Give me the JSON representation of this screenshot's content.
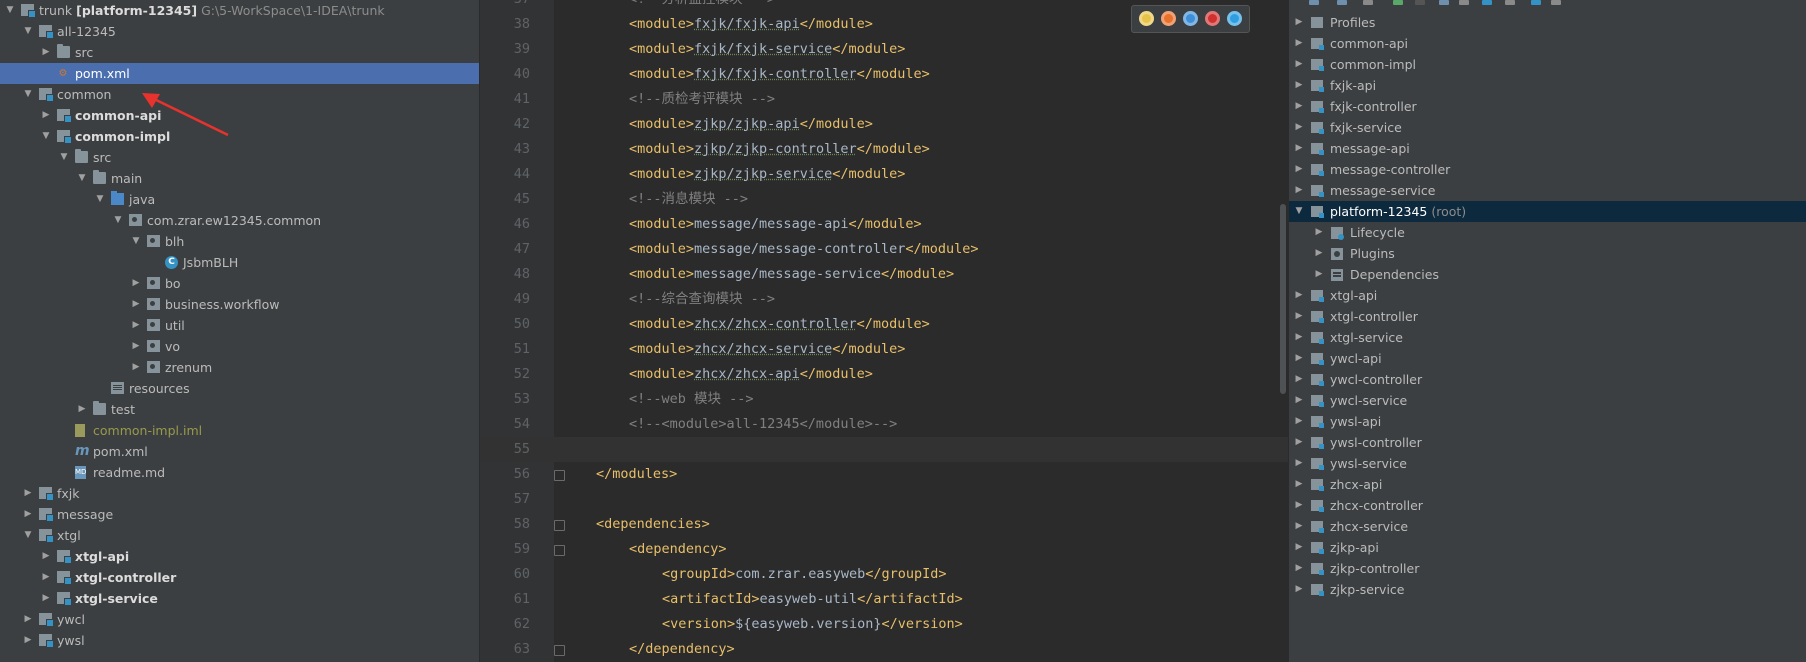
{
  "project_tree": {
    "items": [
      {
        "label": "trunk",
        "bold_suffix": "[platform-12345]",
        "path": "G:\\5-WorkSpace\\1-IDEA\\trunk",
        "depth": 0,
        "arrow": "down",
        "icon": "module-folder-icon"
      },
      {
        "label": "all-12345",
        "depth": 1,
        "arrow": "down",
        "icon": "module-folder-icon"
      },
      {
        "label": "src",
        "depth": 2,
        "arrow": "right",
        "icon": "folder-icon"
      },
      {
        "label": "pom.xml",
        "depth": 2,
        "arrow": "",
        "icon": "maven-file-icon",
        "selected": true
      },
      {
        "label": "common",
        "depth": 1,
        "arrow": "down",
        "icon": "module-folder-icon"
      },
      {
        "label": "common-api",
        "depth": 2,
        "arrow": "right",
        "icon": "module-folder-icon",
        "bold": true
      },
      {
        "label": "common-impl",
        "depth": 2,
        "arrow": "down",
        "icon": "module-folder-icon",
        "bold": true
      },
      {
        "label": "src",
        "depth": 3,
        "arrow": "down",
        "icon": "folder-icon"
      },
      {
        "label": "main",
        "depth": 4,
        "arrow": "down",
        "icon": "folder-icon"
      },
      {
        "label": "java",
        "depth": 5,
        "arrow": "down",
        "icon": "source-folder-icon"
      },
      {
        "label": "com.zrar.ew12345.common",
        "depth": 6,
        "arrow": "down",
        "icon": "package-icon"
      },
      {
        "label": "blh",
        "depth": 7,
        "arrow": "down",
        "icon": "package-icon"
      },
      {
        "label": "JsbmBLH",
        "depth": 8,
        "arrow": "",
        "icon": "class-icon"
      },
      {
        "label": "bo",
        "depth": 7,
        "arrow": "right",
        "icon": "package-icon"
      },
      {
        "label": "business.workflow",
        "depth": 7,
        "arrow": "right",
        "icon": "package-icon"
      },
      {
        "label": "util",
        "depth": 7,
        "arrow": "right",
        "icon": "package-icon"
      },
      {
        "label": "vo",
        "depth": 7,
        "arrow": "right",
        "icon": "package-icon"
      },
      {
        "label": "zrenum",
        "depth": 7,
        "arrow": "right",
        "icon": "package-icon"
      },
      {
        "label": "resources",
        "depth": 5,
        "arrow": "",
        "icon": "resources-folder-icon"
      },
      {
        "label": "test",
        "depth": 4,
        "arrow": "right",
        "icon": "folder-icon"
      },
      {
        "label": "common-impl.iml",
        "depth": 3,
        "arrow": "",
        "icon": "iml-file-icon",
        "olive": true
      },
      {
        "label": "pom.xml",
        "depth": 3,
        "arrow": "",
        "icon": "maven-m-icon"
      },
      {
        "label": "readme.md",
        "depth": 3,
        "arrow": "",
        "icon": "markdown-file-icon"
      },
      {
        "label": "fxjk",
        "depth": 1,
        "arrow": "right",
        "icon": "module-folder-icon"
      },
      {
        "label": "message",
        "depth": 1,
        "arrow": "right",
        "icon": "module-folder-icon"
      },
      {
        "label": "xtgl",
        "depth": 1,
        "arrow": "down",
        "icon": "module-folder-icon"
      },
      {
        "label": "xtgl-api",
        "depth": 2,
        "arrow": "right",
        "icon": "module-folder-icon",
        "bold": true
      },
      {
        "label": "xtgl-controller",
        "depth": 2,
        "arrow": "right",
        "icon": "module-folder-icon",
        "bold": true
      },
      {
        "label": "xtgl-service",
        "depth": 2,
        "arrow": "right",
        "icon": "module-folder-icon",
        "bold": true
      },
      {
        "label": "ywcl",
        "depth": 1,
        "arrow": "right",
        "icon": "module-folder-icon"
      },
      {
        "label": "ywsl",
        "depth": 1,
        "arrow": "right",
        "icon": "module-folder-icon"
      }
    ]
  },
  "editor": {
    "lines": [
      {
        "num": "37",
        "indent": 1,
        "parts": [
          {
            "t": "cmt",
            "v": "<!--分析监控模块 -->"
          }
        ]
      },
      {
        "num": "38",
        "indent": 1,
        "parts": [
          {
            "t": "tag",
            "v": "<module>"
          },
          {
            "t": "txt",
            "v": "fxjk/fxjk-api"
          },
          {
            "t": "tag",
            "v": "</module>"
          }
        ]
      },
      {
        "num": "39",
        "indent": 1,
        "parts": [
          {
            "t": "tag",
            "v": "<module>"
          },
          {
            "t": "txt",
            "v": "fxjk/fxjk-service"
          },
          {
            "t": "tag",
            "v": "</module>"
          }
        ]
      },
      {
        "num": "40",
        "indent": 1,
        "parts": [
          {
            "t": "tag",
            "v": "<module>"
          },
          {
            "t": "txt",
            "v": "fxjk/fxjk-controller"
          },
          {
            "t": "tag",
            "v": "</module>"
          }
        ]
      },
      {
        "num": "41",
        "indent": 1,
        "parts": [
          {
            "t": "cmt",
            "v": "<!--质检考评模块 -->"
          }
        ]
      },
      {
        "num": "42",
        "indent": 1,
        "parts": [
          {
            "t": "tag",
            "v": "<module>"
          },
          {
            "t": "txt",
            "v": "zjkp/zjkp-api"
          },
          {
            "t": "tag",
            "v": "</module>"
          }
        ]
      },
      {
        "num": "43",
        "indent": 1,
        "parts": [
          {
            "t": "tag",
            "v": "<module>"
          },
          {
            "t": "txt",
            "v": "zjkp/zjkp-controller"
          },
          {
            "t": "tag",
            "v": "</module>"
          }
        ]
      },
      {
        "num": "44",
        "indent": 1,
        "parts": [
          {
            "t": "tag",
            "v": "<module>"
          },
          {
            "t": "txt",
            "v": "zjkp/zjkp-service"
          },
          {
            "t": "tag",
            "v": "</module>"
          }
        ]
      },
      {
        "num": "45",
        "indent": 1,
        "parts": [
          {
            "t": "cmt",
            "v": "<!--消息模块 -->"
          }
        ]
      },
      {
        "num": "46",
        "indent": 1,
        "parts": [
          {
            "t": "tag",
            "v": "<module>"
          },
          {
            "t": "txt",
            "v": "message/message-api"
          },
          {
            "t": "tag",
            "v": "</module>"
          }
        ]
      },
      {
        "num": "47",
        "indent": 1,
        "parts": [
          {
            "t": "tag",
            "v": "<module>"
          },
          {
            "t": "txt",
            "v": "message/message-controller"
          },
          {
            "t": "tag",
            "v": "</module>"
          }
        ]
      },
      {
        "num": "48",
        "indent": 1,
        "parts": [
          {
            "t": "tag",
            "v": "<module>"
          },
          {
            "t": "txt",
            "v": "message/message-service"
          },
          {
            "t": "tag",
            "v": "</module>"
          }
        ]
      },
      {
        "num": "49",
        "indent": 1,
        "parts": [
          {
            "t": "cmt",
            "v": "<!--综合查询模块 -->"
          }
        ]
      },
      {
        "num": "50",
        "indent": 1,
        "parts": [
          {
            "t": "tag",
            "v": "<module>"
          },
          {
            "t": "txt",
            "v": "zhcx/zhcx-controller"
          },
          {
            "t": "tag",
            "v": "</module>"
          }
        ]
      },
      {
        "num": "51",
        "indent": 1,
        "parts": [
          {
            "t": "tag",
            "v": "<module>"
          },
          {
            "t": "txt",
            "v": "zhcx/zhcx-service"
          },
          {
            "t": "tag",
            "v": "</module>"
          }
        ]
      },
      {
        "num": "52",
        "indent": 1,
        "parts": [
          {
            "t": "tag",
            "v": "<module>"
          },
          {
            "t": "txt",
            "v": "zhcx/zhcx-api"
          },
          {
            "t": "tag",
            "v": "</module>"
          }
        ]
      },
      {
        "num": "53",
        "indent": 1,
        "parts": [
          {
            "t": "cmt",
            "v": "<!--web 模块 -->"
          }
        ]
      },
      {
        "num": "54",
        "indent": 1,
        "parts": [
          {
            "t": "cmt",
            "v": "<!--<module>all-12345</module>-->"
          }
        ]
      },
      {
        "num": "55",
        "indent": 0,
        "parts": [],
        "current": true
      },
      {
        "num": "56",
        "indent": 0,
        "parts": [
          {
            "t": "tag",
            "v": "</modules>"
          }
        ],
        "fold": true
      },
      {
        "num": "57",
        "indent": 0,
        "parts": []
      },
      {
        "num": "58",
        "indent": 0,
        "parts": [
          {
            "t": "tag",
            "v": "<dependencies>"
          }
        ],
        "fold": true
      },
      {
        "num": "59",
        "indent": 1,
        "parts": [
          {
            "t": "tag",
            "v": "<dependency>"
          }
        ],
        "fold": true
      },
      {
        "num": "60",
        "indent": 2,
        "parts": [
          {
            "t": "tag",
            "v": "<groupId>"
          },
          {
            "t": "txt",
            "v": "com.zrar.easyweb"
          },
          {
            "t": "tag",
            "v": "</groupId>"
          }
        ]
      },
      {
        "num": "61",
        "indent": 2,
        "parts": [
          {
            "t": "tag",
            "v": "<artifactId>"
          },
          {
            "t": "txt",
            "v": "easyweb-util"
          },
          {
            "t": "tag",
            "v": "</artifactId>"
          }
        ]
      },
      {
        "num": "62",
        "indent": 2,
        "parts": [
          {
            "t": "tag",
            "v": "<version>"
          },
          {
            "t": "txt",
            "v": "${easyweb.version}"
          },
          {
            "t": "tag",
            "v": "</version>"
          }
        ]
      },
      {
        "num": "63",
        "indent": 1,
        "parts": [
          {
            "t": "tag",
            "v": "</dependency>"
          }
        ],
        "fold": true
      }
    ],
    "browsers": [
      {
        "name": "chrome-icon",
        "color": "#e8c34a"
      },
      {
        "name": "firefox-icon",
        "color": "#e8712b"
      },
      {
        "name": "safari-icon",
        "color": "#3f8fd8"
      },
      {
        "name": "opera-icon",
        "color": "#d0302f"
      },
      {
        "name": "ie-icon",
        "color": "#2e9ee0"
      }
    ]
  },
  "maven": {
    "items": [
      {
        "label": "Profiles",
        "depth": 0,
        "arrow": "right",
        "icon": "profiles-icon"
      },
      {
        "label": "common-api",
        "depth": 0,
        "arrow": "right",
        "icon": "maven-module-icon"
      },
      {
        "label": "common-impl",
        "depth": 0,
        "arrow": "right",
        "icon": "maven-module-icon"
      },
      {
        "label": "fxjk-api",
        "depth": 0,
        "arrow": "right",
        "icon": "maven-module-icon"
      },
      {
        "label": "fxjk-controller",
        "depth": 0,
        "arrow": "right",
        "icon": "maven-module-icon"
      },
      {
        "label": "fxjk-service",
        "depth": 0,
        "arrow": "right",
        "icon": "maven-module-icon"
      },
      {
        "label": "message-api",
        "depth": 0,
        "arrow": "right",
        "icon": "maven-module-icon"
      },
      {
        "label": "message-controller",
        "depth": 0,
        "arrow": "right",
        "icon": "maven-module-icon"
      },
      {
        "label": "message-service",
        "depth": 0,
        "arrow": "right",
        "icon": "maven-module-icon"
      },
      {
        "label": "platform-12345",
        "suffix": "(root)",
        "depth": 0,
        "arrow": "down",
        "icon": "maven-module-icon",
        "selected": true
      },
      {
        "label": "Lifecycle",
        "depth": 1,
        "arrow": "right",
        "icon": "lifecycle-icon"
      },
      {
        "label": "Plugins",
        "depth": 1,
        "arrow": "right",
        "icon": "plugins-icon"
      },
      {
        "label": "Dependencies",
        "depth": 1,
        "arrow": "right",
        "icon": "dependencies-icon"
      },
      {
        "label": "xtgl-api",
        "depth": 0,
        "arrow": "right",
        "icon": "maven-module-icon"
      },
      {
        "label": "xtgl-controller",
        "depth": 0,
        "arrow": "right",
        "icon": "maven-module-icon"
      },
      {
        "label": "xtgl-service",
        "depth": 0,
        "arrow": "right",
        "icon": "maven-module-icon"
      },
      {
        "label": "ywcl-api",
        "depth": 0,
        "arrow": "right",
        "icon": "maven-module-icon"
      },
      {
        "label": "ywcl-controller",
        "depth": 0,
        "arrow": "right",
        "icon": "maven-module-icon"
      },
      {
        "label": "ywcl-service",
        "depth": 0,
        "arrow": "right",
        "icon": "maven-module-icon"
      },
      {
        "label": "ywsl-api",
        "depth": 0,
        "arrow": "right",
        "icon": "maven-module-icon"
      },
      {
        "label": "ywsl-controller",
        "depth": 0,
        "arrow": "right",
        "icon": "maven-module-icon"
      },
      {
        "label": "ywsl-service",
        "depth": 0,
        "arrow": "right",
        "icon": "maven-module-icon"
      },
      {
        "label": "zhcx-api",
        "depth": 0,
        "arrow": "right",
        "icon": "maven-module-icon"
      },
      {
        "label": "zhcx-controller",
        "depth": 0,
        "arrow": "right",
        "icon": "maven-module-icon"
      },
      {
        "label": "zhcx-service",
        "depth": 0,
        "arrow": "right",
        "icon": "maven-module-icon"
      },
      {
        "label": "zjkp-api",
        "depth": 0,
        "arrow": "right",
        "icon": "maven-module-icon"
      },
      {
        "label": "zjkp-controller",
        "depth": 0,
        "arrow": "right",
        "icon": "maven-module-icon"
      },
      {
        "label": "zjkp-service",
        "depth": 0,
        "arrow": "right",
        "icon": "maven-module-icon"
      }
    ]
  },
  "colors": {
    "selection": "#4b6eaf",
    "maven_selection": "#0d293e",
    "annotation_arrow": "#e8322d"
  }
}
